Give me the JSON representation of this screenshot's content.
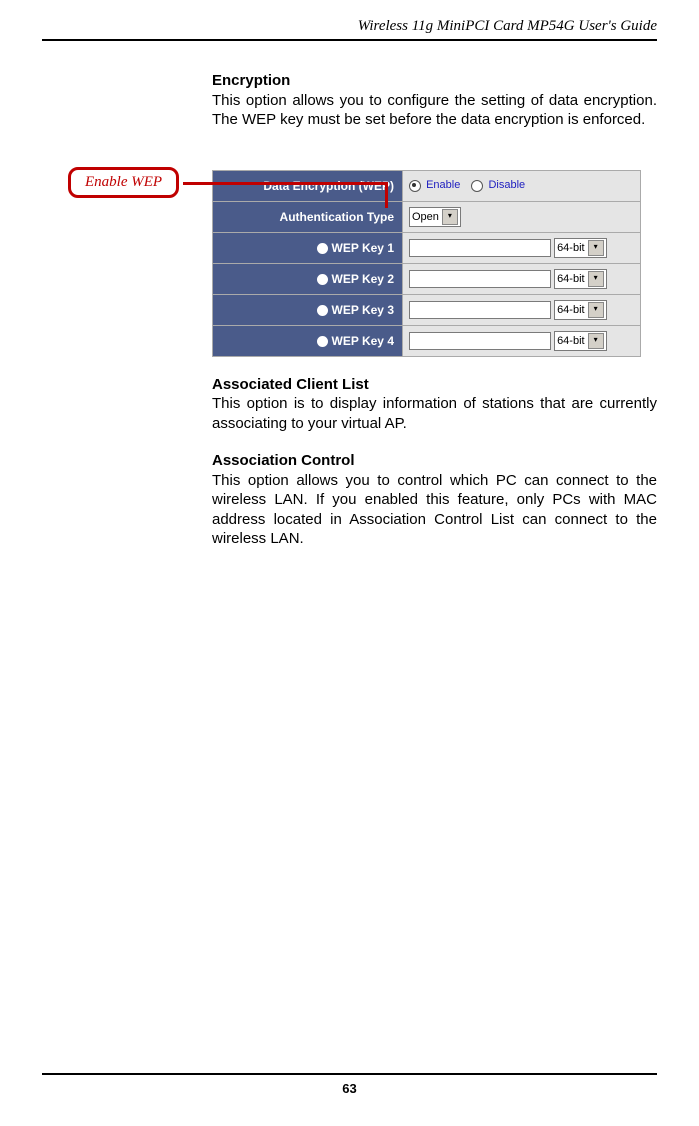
{
  "header": {
    "title": "Wireless 11g MiniPCI Card MP54G User's Guide"
  },
  "callout": {
    "label": "Enable WEP"
  },
  "sections": [
    {
      "heading": "Encryption",
      "body": "This option allows you to configure the setting of data encryption.  The WEP key must be set before the data encryption is enforced."
    },
    {
      "heading": "Associated Client List",
      "body": "This option is to display information of stations that are currently associating to your virtual AP."
    },
    {
      "heading": "Association Control",
      "body": "This option allows you to control which PC can connect to the wireless LAN.  If you enabled this feature, only PCs with MAC address located in Association Control List can connect to the wireless LAN."
    }
  ],
  "config_table": {
    "rows": [
      {
        "label": "Data Encryption (WEP)",
        "type": "radio",
        "options": [
          "Enable",
          "Disable"
        ],
        "selected": "Enable"
      },
      {
        "label": "Authentication Type",
        "type": "select",
        "value": "Open"
      },
      {
        "label": "WEP Key 1",
        "type": "key",
        "size": "64-bit"
      },
      {
        "label": "WEP Key 2",
        "type": "key",
        "size": "64-bit"
      },
      {
        "label": "WEP Key 3",
        "type": "key",
        "size": "64-bit"
      },
      {
        "label": "WEP Key 4",
        "type": "key",
        "size": "64-bit"
      }
    ]
  },
  "footer": {
    "page": "63"
  }
}
